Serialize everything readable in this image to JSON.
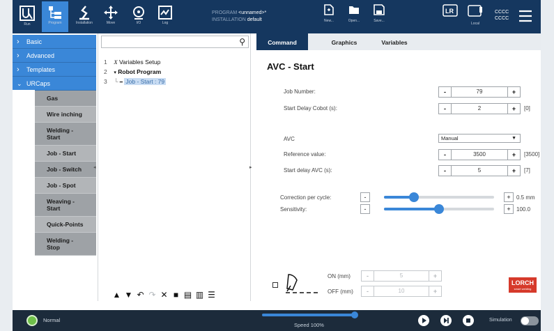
{
  "header": {
    "nav": [
      {
        "label": "Run",
        "icon": "run-icon"
      },
      {
        "label": "Program",
        "icon": "program-icon"
      },
      {
        "label": "Installation",
        "icon": "installation-icon"
      },
      {
        "label": "Move",
        "icon": "move-icon"
      },
      {
        "label": "I/O",
        "icon": "io-icon"
      },
      {
        "label": "Log",
        "icon": "log-icon"
      }
    ],
    "program_prefix": "PROGRAM",
    "program_name": "<unnamed>*",
    "installation_prefix": "INSTALLATION",
    "installation_name": "default",
    "file_buttons": [
      {
        "label": "New...",
        "icon": "new-file-icon"
      },
      {
        "label": "Open...",
        "icon": "open-folder-icon"
      },
      {
        "label": "Save...",
        "icon": "save-icon"
      }
    ],
    "local_label": "Local",
    "cccc_1": "CCCC",
    "cccc_2": "CCCC",
    "accent": "#3a87d8",
    "bar_color": "#15375f"
  },
  "categories": [
    "Basic",
    "Advanced",
    "Templates",
    "URCaps"
  ],
  "urcaps_items": [
    "Gas",
    "Wire inching",
    "Welding - Start",
    "Job - Start",
    "Job - Switch",
    "Job - Spot",
    "Weaving - Start",
    "Quick-Points",
    "Welding - Stop"
  ],
  "tree": {
    "search_placeholder": "",
    "rows": [
      {
        "num": "1",
        "prefix": "X",
        "text": "Variables Setup"
      },
      {
        "num": "2",
        "prefix": "▾",
        "text": "Robot Program"
      },
      {
        "num": "3",
        "prefix": "━",
        "text": "Job - Start : 79"
      }
    ]
  },
  "tabs": [
    "Command",
    "Graphics",
    "Variables"
  ],
  "panel": {
    "title": "AVC - Start",
    "job_number_label": "Job Number:",
    "job_number": "79",
    "start_delay_label": "Start Delay Cobot (s):",
    "start_delay": "2",
    "start_delay_hint": "[0]",
    "avc_label": "AVC",
    "avc_value": "Manual",
    "reference_label": "Reference value:",
    "reference_value": "3500",
    "reference_hint": "[3500]",
    "avc_delay_label": "Start delay AVC (s):",
    "avc_delay": "5",
    "avc_delay_hint": "[7]",
    "correction_label": "Correction per cycle:",
    "correction_value": "0.5 mm",
    "correction_fraction": 0.27,
    "sensitivity_label": "Sensitivity:",
    "sensitivity_value": "100.0",
    "sensitivity_fraction": 0.5,
    "on_label": "ON (mm)",
    "on_value": "5",
    "off_label": "OFF (mm)",
    "off_value": "10",
    "logo_text": "LORCH",
    "logo_sub": "smart welding",
    "minus": "-",
    "plus": "+"
  },
  "footer": {
    "status": "Normal",
    "speed": "Speed 100%",
    "simulation": "Simulation"
  }
}
